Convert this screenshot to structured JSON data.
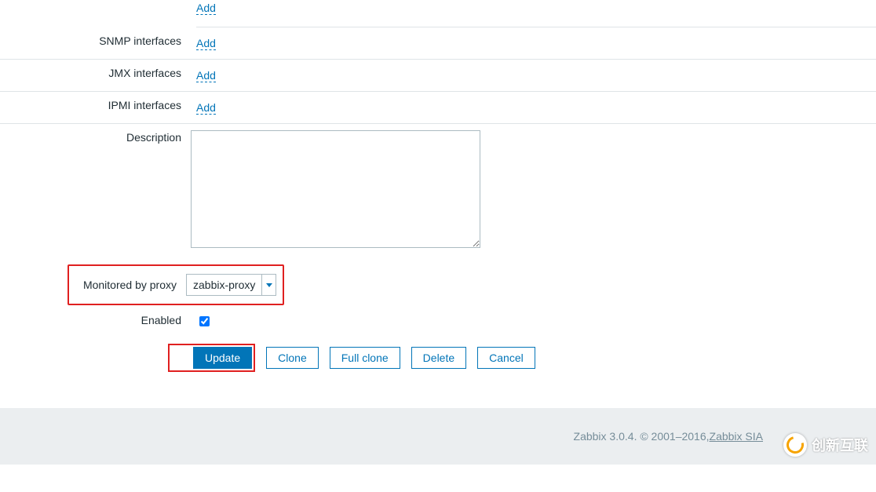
{
  "top_add": "Add",
  "interfaces": [
    {
      "label": "SNMP interfaces",
      "add": "Add"
    },
    {
      "label": "JMX interfaces",
      "add": "Add"
    },
    {
      "label": "IPMI interfaces",
      "add": "Add"
    }
  ],
  "description_label": "Description",
  "description_value": "",
  "proxy": {
    "label": "Monitored by proxy",
    "selected": "zabbix-proxy"
  },
  "enabled": {
    "label": "Enabled",
    "checked": true
  },
  "buttons": {
    "update": "Update",
    "clone": "Clone",
    "full_clone": "Full clone",
    "delete": "Delete",
    "cancel": "Cancel"
  },
  "footer": {
    "text": "Zabbix 3.0.4. © 2001–2016, ",
    "link": "Zabbix SIA"
  },
  "watermark": "创新互联"
}
